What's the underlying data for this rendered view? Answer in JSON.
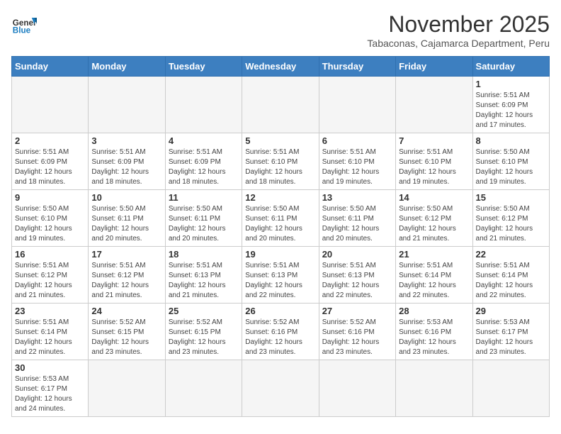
{
  "header": {
    "logo_general": "General",
    "logo_blue": "Blue",
    "title": "November 2025",
    "subtitle": "Tabaconas, Cajamarca Department, Peru"
  },
  "days_of_week": [
    "Sunday",
    "Monday",
    "Tuesday",
    "Wednesday",
    "Thursday",
    "Friday",
    "Saturday"
  ],
  "weeks": [
    [
      {
        "day": "",
        "info": ""
      },
      {
        "day": "",
        "info": ""
      },
      {
        "day": "",
        "info": ""
      },
      {
        "day": "",
        "info": ""
      },
      {
        "day": "",
        "info": ""
      },
      {
        "day": "",
        "info": ""
      },
      {
        "day": "1",
        "info": "Sunrise: 5:51 AM\nSunset: 6:09 PM\nDaylight: 12 hours\nand 17 minutes."
      }
    ],
    [
      {
        "day": "2",
        "info": "Sunrise: 5:51 AM\nSunset: 6:09 PM\nDaylight: 12 hours\nand 18 minutes."
      },
      {
        "day": "3",
        "info": "Sunrise: 5:51 AM\nSunset: 6:09 PM\nDaylight: 12 hours\nand 18 minutes."
      },
      {
        "day": "4",
        "info": "Sunrise: 5:51 AM\nSunset: 6:09 PM\nDaylight: 12 hours\nand 18 minutes."
      },
      {
        "day": "5",
        "info": "Sunrise: 5:51 AM\nSunset: 6:10 PM\nDaylight: 12 hours\nand 18 minutes."
      },
      {
        "day": "6",
        "info": "Sunrise: 5:51 AM\nSunset: 6:10 PM\nDaylight: 12 hours\nand 19 minutes."
      },
      {
        "day": "7",
        "info": "Sunrise: 5:51 AM\nSunset: 6:10 PM\nDaylight: 12 hours\nand 19 minutes."
      },
      {
        "day": "8",
        "info": "Sunrise: 5:50 AM\nSunset: 6:10 PM\nDaylight: 12 hours\nand 19 minutes."
      }
    ],
    [
      {
        "day": "9",
        "info": "Sunrise: 5:50 AM\nSunset: 6:10 PM\nDaylight: 12 hours\nand 19 minutes."
      },
      {
        "day": "10",
        "info": "Sunrise: 5:50 AM\nSunset: 6:11 PM\nDaylight: 12 hours\nand 20 minutes."
      },
      {
        "day": "11",
        "info": "Sunrise: 5:50 AM\nSunset: 6:11 PM\nDaylight: 12 hours\nand 20 minutes."
      },
      {
        "day": "12",
        "info": "Sunrise: 5:50 AM\nSunset: 6:11 PM\nDaylight: 12 hours\nand 20 minutes."
      },
      {
        "day": "13",
        "info": "Sunrise: 5:50 AM\nSunset: 6:11 PM\nDaylight: 12 hours\nand 20 minutes."
      },
      {
        "day": "14",
        "info": "Sunrise: 5:50 AM\nSunset: 6:12 PM\nDaylight: 12 hours\nand 21 minutes."
      },
      {
        "day": "15",
        "info": "Sunrise: 5:50 AM\nSunset: 6:12 PM\nDaylight: 12 hours\nand 21 minutes."
      }
    ],
    [
      {
        "day": "16",
        "info": "Sunrise: 5:51 AM\nSunset: 6:12 PM\nDaylight: 12 hours\nand 21 minutes."
      },
      {
        "day": "17",
        "info": "Sunrise: 5:51 AM\nSunset: 6:12 PM\nDaylight: 12 hours\nand 21 minutes."
      },
      {
        "day": "18",
        "info": "Sunrise: 5:51 AM\nSunset: 6:13 PM\nDaylight: 12 hours\nand 21 minutes."
      },
      {
        "day": "19",
        "info": "Sunrise: 5:51 AM\nSunset: 6:13 PM\nDaylight: 12 hours\nand 22 minutes."
      },
      {
        "day": "20",
        "info": "Sunrise: 5:51 AM\nSunset: 6:13 PM\nDaylight: 12 hours\nand 22 minutes."
      },
      {
        "day": "21",
        "info": "Sunrise: 5:51 AM\nSunset: 6:14 PM\nDaylight: 12 hours\nand 22 minutes."
      },
      {
        "day": "22",
        "info": "Sunrise: 5:51 AM\nSunset: 6:14 PM\nDaylight: 12 hours\nand 22 minutes."
      }
    ],
    [
      {
        "day": "23",
        "info": "Sunrise: 5:51 AM\nSunset: 6:14 PM\nDaylight: 12 hours\nand 22 minutes."
      },
      {
        "day": "24",
        "info": "Sunrise: 5:52 AM\nSunset: 6:15 PM\nDaylight: 12 hours\nand 23 minutes."
      },
      {
        "day": "25",
        "info": "Sunrise: 5:52 AM\nSunset: 6:15 PM\nDaylight: 12 hours\nand 23 minutes."
      },
      {
        "day": "26",
        "info": "Sunrise: 5:52 AM\nSunset: 6:16 PM\nDaylight: 12 hours\nand 23 minutes."
      },
      {
        "day": "27",
        "info": "Sunrise: 5:52 AM\nSunset: 6:16 PM\nDaylight: 12 hours\nand 23 minutes."
      },
      {
        "day": "28",
        "info": "Sunrise: 5:53 AM\nSunset: 6:16 PM\nDaylight: 12 hours\nand 23 minutes."
      },
      {
        "day": "29",
        "info": "Sunrise: 5:53 AM\nSunset: 6:17 PM\nDaylight: 12 hours\nand 23 minutes."
      }
    ],
    [
      {
        "day": "30",
        "info": "Sunrise: 5:53 AM\nSunset: 6:17 PM\nDaylight: 12 hours\nand 24 minutes."
      },
      {
        "day": "",
        "info": ""
      },
      {
        "day": "",
        "info": ""
      },
      {
        "day": "",
        "info": ""
      },
      {
        "day": "",
        "info": ""
      },
      {
        "day": "",
        "info": ""
      },
      {
        "day": "",
        "info": ""
      }
    ]
  ]
}
